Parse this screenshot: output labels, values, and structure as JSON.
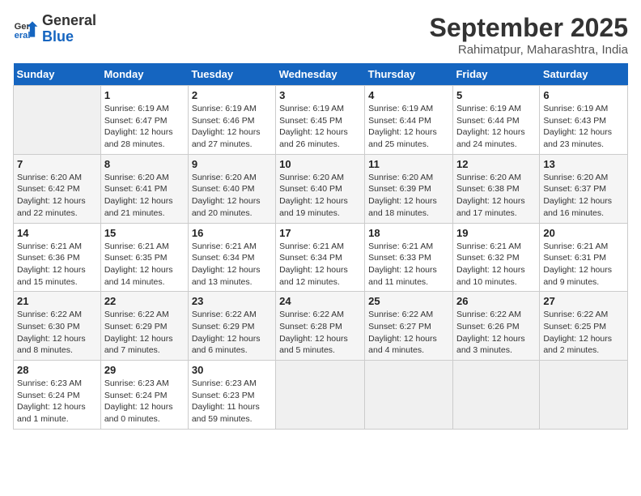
{
  "logo": {
    "line1": "General",
    "line2": "Blue"
  },
  "title": "September 2025",
  "subtitle": "Rahimatpur, Maharashtra, India",
  "days_of_week": [
    "Sunday",
    "Monday",
    "Tuesday",
    "Wednesday",
    "Thursday",
    "Friday",
    "Saturday"
  ],
  "weeks": [
    [
      {
        "num": "",
        "info": ""
      },
      {
        "num": "1",
        "info": "Sunrise: 6:19 AM\nSunset: 6:47 PM\nDaylight: 12 hours\nand 28 minutes."
      },
      {
        "num": "2",
        "info": "Sunrise: 6:19 AM\nSunset: 6:46 PM\nDaylight: 12 hours\nand 27 minutes."
      },
      {
        "num": "3",
        "info": "Sunrise: 6:19 AM\nSunset: 6:45 PM\nDaylight: 12 hours\nand 26 minutes."
      },
      {
        "num": "4",
        "info": "Sunrise: 6:19 AM\nSunset: 6:44 PM\nDaylight: 12 hours\nand 25 minutes."
      },
      {
        "num": "5",
        "info": "Sunrise: 6:19 AM\nSunset: 6:44 PM\nDaylight: 12 hours\nand 24 minutes."
      },
      {
        "num": "6",
        "info": "Sunrise: 6:19 AM\nSunset: 6:43 PM\nDaylight: 12 hours\nand 23 minutes."
      }
    ],
    [
      {
        "num": "7",
        "info": "Sunrise: 6:20 AM\nSunset: 6:42 PM\nDaylight: 12 hours\nand 22 minutes."
      },
      {
        "num": "8",
        "info": "Sunrise: 6:20 AM\nSunset: 6:41 PM\nDaylight: 12 hours\nand 21 minutes."
      },
      {
        "num": "9",
        "info": "Sunrise: 6:20 AM\nSunset: 6:40 PM\nDaylight: 12 hours\nand 20 minutes."
      },
      {
        "num": "10",
        "info": "Sunrise: 6:20 AM\nSunset: 6:40 PM\nDaylight: 12 hours\nand 19 minutes."
      },
      {
        "num": "11",
        "info": "Sunrise: 6:20 AM\nSunset: 6:39 PM\nDaylight: 12 hours\nand 18 minutes."
      },
      {
        "num": "12",
        "info": "Sunrise: 6:20 AM\nSunset: 6:38 PM\nDaylight: 12 hours\nand 17 minutes."
      },
      {
        "num": "13",
        "info": "Sunrise: 6:20 AM\nSunset: 6:37 PM\nDaylight: 12 hours\nand 16 minutes."
      }
    ],
    [
      {
        "num": "14",
        "info": "Sunrise: 6:21 AM\nSunset: 6:36 PM\nDaylight: 12 hours\nand 15 minutes."
      },
      {
        "num": "15",
        "info": "Sunrise: 6:21 AM\nSunset: 6:35 PM\nDaylight: 12 hours\nand 14 minutes."
      },
      {
        "num": "16",
        "info": "Sunrise: 6:21 AM\nSunset: 6:34 PM\nDaylight: 12 hours\nand 13 minutes."
      },
      {
        "num": "17",
        "info": "Sunrise: 6:21 AM\nSunset: 6:34 PM\nDaylight: 12 hours\nand 12 minutes."
      },
      {
        "num": "18",
        "info": "Sunrise: 6:21 AM\nSunset: 6:33 PM\nDaylight: 12 hours\nand 11 minutes."
      },
      {
        "num": "19",
        "info": "Sunrise: 6:21 AM\nSunset: 6:32 PM\nDaylight: 12 hours\nand 10 minutes."
      },
      {
        "num": "20",
        "info": "Sunrise: 6:21 AM\nSunset: 6:31 PM\nDaylight: 12 hours\nand 9 minutes."
      }
    ],
    [
      {
        "num": "21",
        "info": "Sunrise: 6:22 AM\nSunset: 6:30 PM\nDaylight: 12 hours\nand 8 minutes."
      },
      {
        "num": "22",
        "info": "Sunrise: 6:22 AM\nSunset: 6:29 PM\nDaylight: 12 hours\nand 7 minutes."
      },
      {
        "num": "23",
        "info": "Sunrise: 6:22 AM\nSunset: 6:29 PM\nDaylight: 12 hours\nand 6 minutes."
      },
      {
        "num": "24",
        "info": "Sunrise: 6:22 AM\nSunset: 6:28 PM\nDaylight: 12 hours\nand 5 minutes."
      },
      {
        "num": "25",
        "info": "Sunrise: 6:22 AM\nSunset: 6:27 PM\nDaylight: 12 hours\nand 4 minutes."
      },
      {
        "num": "26",
        "info": "Sunrise: 6:22 AM\nSunset: 6:26 PM\nDaylight: 12 hours\nand 3 minutes."
      },
      {
        "num": "27",
        "info": "Sunrise: 6:22 AM\nSunset: 6:25 PM\nDaylight: 12 hours\nand 2 minutes."
      }
    ],
    [
      {
        "num": "28",
        "info": "Sunrise: 6:23 AM\nSunset: 6:24 PM\nDaylight: 12 hours\nand 1 minute."
      },
      {
        "num": "29",
        "info": "Sunrise: 6:23 AM\nSunset: 6:24 PM\nDaylight: 12 hours\nand 0 minutes."
      },
      {
        "num": "30",
        "info": "Sunrise: 6:23 AM\nSunset: 6:23 PM\nDaylight: 11 hours\nand 59 minutes."
      },
      {
        "num": "",
        "info": ""
      },
      {
        "num": "",
        "info": ""
      },
      {
        "num": "",
        "info": ""
      },
      {
        "num": "",
        "info": ""
      }
    ]
  ]
}
